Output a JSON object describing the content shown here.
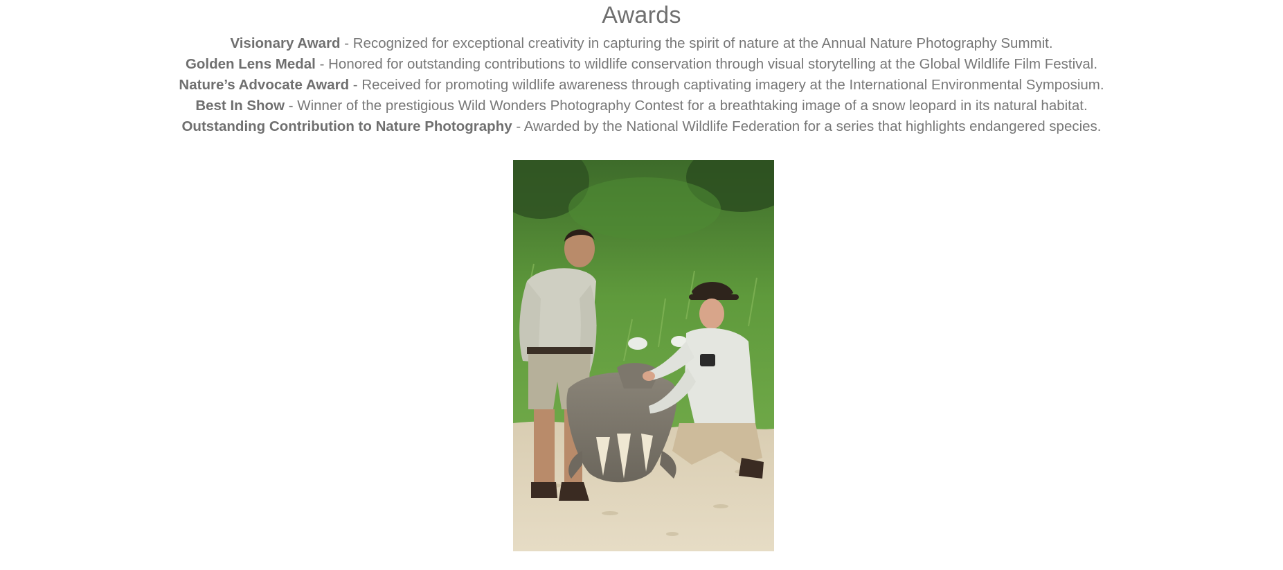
{
  "awards": {
    "heading": "Awards",
    "items": [
      {
        "name": "Visionary Award",
        "description": " - Recognized for exceptional creativity in capturing the spirit of nature at the Annual Nature Photography Summit."
      },
      {
        "name": "Golden Lens Medal",
        "description": " - Honored for outstanding contributions to wildlife conservation through visual storytelling at the Global Wildlife Film Festival."
      },
      {
        "name": "Nature’s Advocate Award",
        "description": " - Received for promoting wildlife awareness through captivating imagery at the International Environmental Symposium."
      },
      {
        "name": "Best In Show",
        "description": " - Winner of the prestigious Wild Wonders Photography Contest for a breathtaking image of a snow leopard in its natural habitat."
      },
      {
        "name": "Outstanding Contribution to Nature Photography",
        "description": " - Awarded by the National Wildlife Federation for a series that highlights endangered species."
      }
    ]
  },
  "photo": {
    "subject": "two men in safari clothing examining an elephant skull on sand in front of green grass"
  },
  "colors": {
    "text": "#777777",
    "heading": "#6f6f6f",
    "background": "#ffffff"
  }
}
